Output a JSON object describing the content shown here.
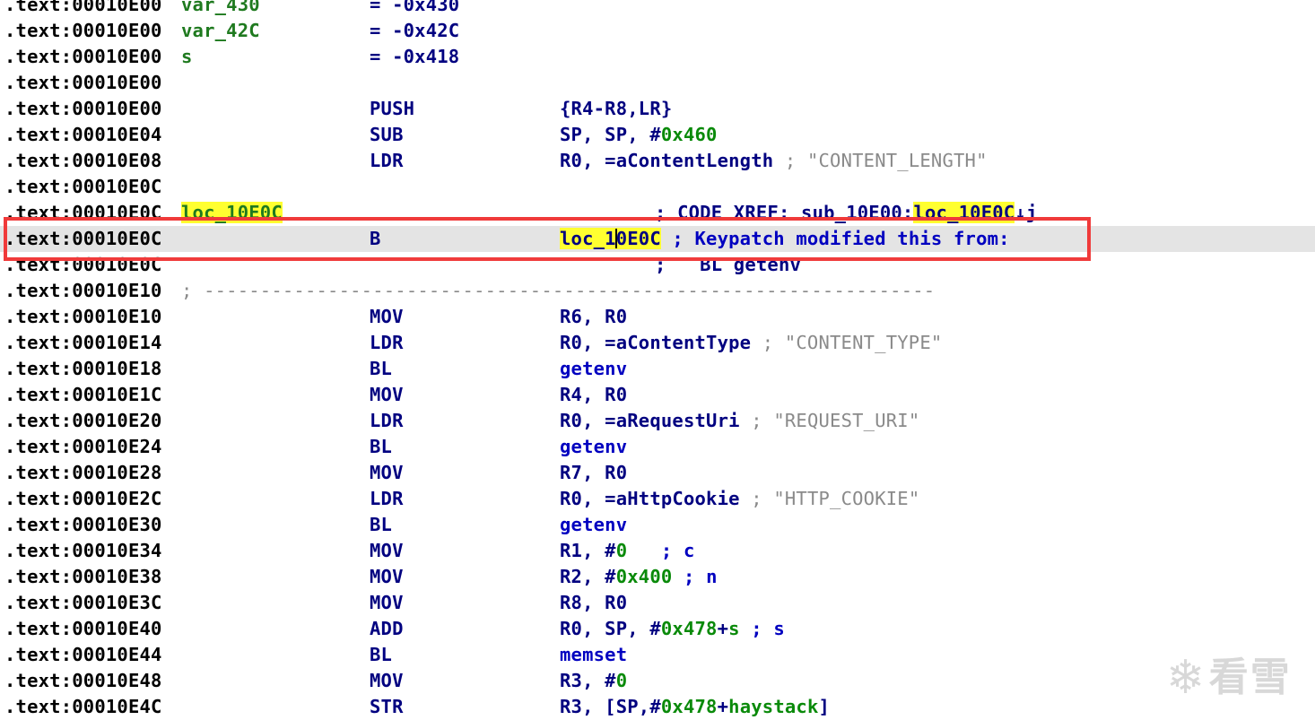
{
  "listing": [
    {
      "addr": ".text:00010E00",
      "name": "var_430",
      "eq": "= -0x430"
    },
    {
      "addr": ".text:00010E00",
      "name": "var_42C",
      "eq": "= -0x42C"
    },
    {
      "addr": ".text:00010E00",
      "name": "s",
      "eq": "= -0x418"
    },
    {
      "addr": ".text:00010E00"
    },
    {
      "addr": ".text:00010E00",
      "mnemonic": "PUSH",
      "ops": "{R4-R8,LR}"
    },
    {
      "addr": ".text:00010E04",
      "mnemonic": "SUB",
      "ops_a": "SP, SP, #",
      "ops_num": "0x460"
    },
    {
      "addr": ".text:00010E08",
      "mnemonic": "LDR",
      "ops": "R0, =aContentLength",
      "cmt": " ; \"CONTENT_LENGTH\""
    },
    {
      "addr": ".text:00010E0C"
    },
    {
      "addr": ".text:00010E0C",
      "label": "loc_10E0C",
      "xref_pre": "; CODE XREF: sub_10E00:",
      "xref_hl": "loc_10E0C",
      "xref_post": "↓j"
    },
    {
      "addr": ".text:00010E0C",
      "mnemonic": "B",
      "target_a": "loc_1",
      "target_b": "0E0C",
      "cmt": " ; Keypatch modified this from:"
    },
    {
      "addr": ".text:00010E0C",
      "cmt_only": ";   BL getenv"
    },
    {
      "addr": ".text:00010E10",
      "separator": "; -----------------------------------------------------------------"
    },
    {
      "addr": ".text:00010E10",
      "mnemonic": "MOV",
      "ops": "R6, R0"
    },
    {
      "addr": ".text:00010E14",
      "mnemonic": "LDR",
      "ops": "R0, =aContentType",
      "cmt": " ; \"CONTENT_TYPE\""
    },
    {
      "addr": ".text:00010E18",
      "mnemonic": "BL",
      "call": "getenv"
    },
    {
      "addr": ".text:00010E1C",
      "mnemonic": "MOV",
      "ops": "R4, R0"
    },
    {
      "addr": ".text:00010E20",
      "mnemonic": "LDR",
      "ops": "R0, =aRequestUri",
      "cmt": " ; \"REQUEST_URI\""
    },
    {
      "addr": ".text:00010E24",
      "mnemonic": "BL",
      "call": "getenv"
    },
    {
      "addr": ".text:00010E28",
      "mnemonic": "MOV",
      "ops": "R7, R0"
    },
    {
      "addr": ".text:00010E2C",
      "mnemonic": "LDR",
      "ops": "R0, =aHttpCookie",
      "cmt": " ; \"HTTP_COOKIE\""
    },
    {
      "addr": ".text:00010E30",
      "mnemonic": "BL",
      "call": "getenv"
    },
    {
      "addr": ".text:00010E34",
      "mnemonic": "MOV",
      "ops_a": "R1, #",
      "ops_num": "0",
      "arg_cmt": "   ; c"
    },
    {
      "addr": ".text:00010E38",
      "mnemonic": "MOV",
      "ops_a": "R2, #",
      "ops_num": "0x400",
      "arg_cmt": " ; n"
    },
    {
      "addr": ".text:00010E3C",
      "mnemonic": "MOV",
      "ops": "R8, R0"
    },
    {
      "addr": ".text:00010E40",
      "mnemonic": "ADD",
      "ops_a": "R0, SP, #",
      "ops_num": "0x478",
      "ops_b": "+",
      "ops_var": "s",
      "arg_cmt": " ; s"
    },
    {
      "addr": ".text:00010E44",
      "mnemonic": "BL",
      "call": "memset"
    },
    {
      "addr": ".text:00010E48",
      "mnemonic": "MOV",
      "ops_a": "R3, #",
      "ops_num": "0"
    },
    {
      "addr": ".text:00010E4C",
      "mnemonic": "STR",
      "ops_a": "R3, [SP,#",
      "ops_num": "0x478",
      "ops_b": "+",
      "ops_var": "haystack",
      "ops_c": "]"
    }
  ],
  "selected_row_index": 9,
  "watermark": {
    "icon": "snowflake-icon",
    "text": "看雪"
  },
  "colors": {
    "highlight": "#ffff30",
    "selection": "#e4e4e4",
    "annotation_box": "#f03a3a",
    "name_green": "#1f7a1f",
    "keyword_navy": "#000080",
    "comment_gray": "#8a8a8a"
  }
}
